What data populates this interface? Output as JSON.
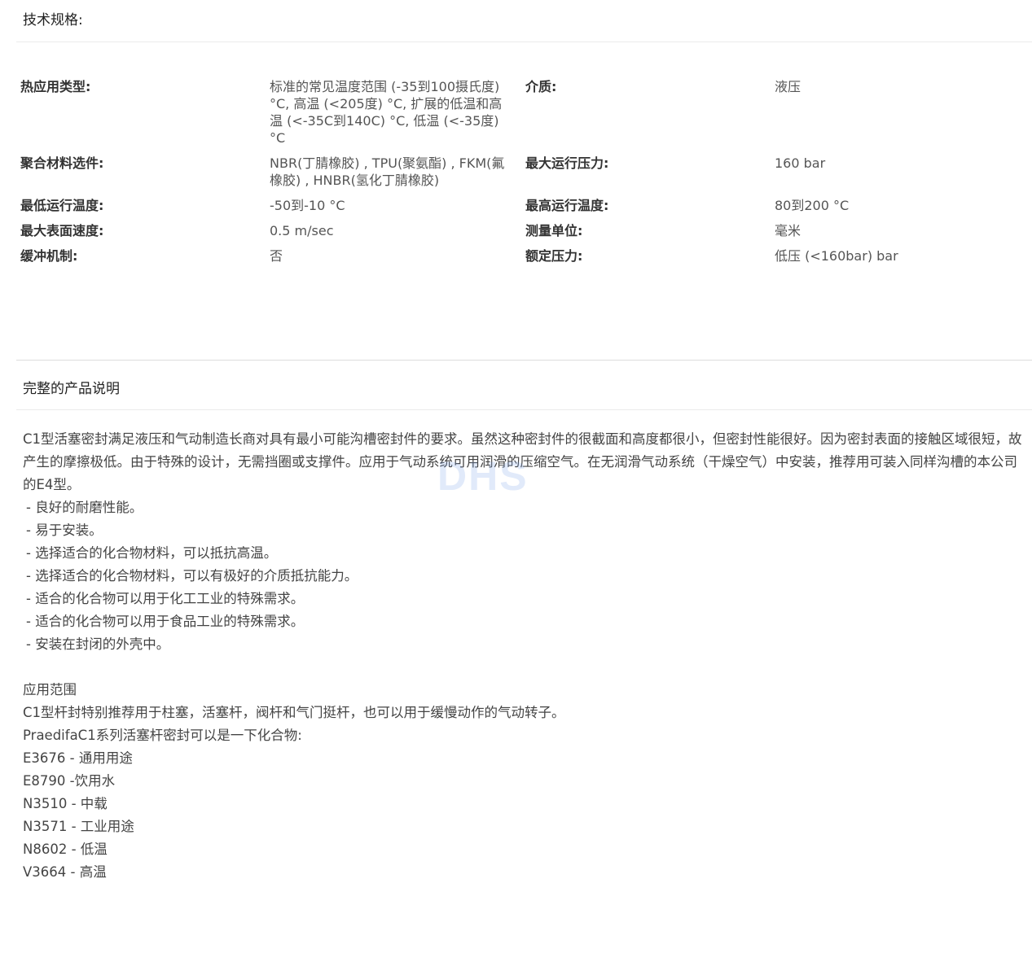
{
  "specs": {
    "header": "技术规格:",
    "rows": [
      [
        {
          "label": "热应用类型:",
          "value": "标准的常见温度范围 (-35到100摄氏度) °C, 高温 (<205度) °C, 扩展的低温和高温 (<-35C到140C) °C, 低温 (<-35度) °C"
        },
        {
          "label": "介质:",
          "value": "液压"
        }
      ],
      [
        {
          "label": "聚合材料选件:",
          "value": "NBR(丁腈橡胶) , TPU(聚氨酯) , FKM(氟橡胶) , HNBR(氢化丁腈橡胶)"
        },
        {
          "label": "最大运行压力:",
          "value": "160 bar"
        }
      ],
      [
        {
          "label": "最低运行温度:",
          "value": "-50到-10 °C"
        },
        {
          "label": "最高运行温度:",
          "value": "80到200 °C"
        }
      ],
      [
        {
          "label": "最大表面速度:",
          "value": "0.5 m/sec"
        },
        {
          "label": "测量单位:",
          "value": "毫米"
        }
      ],
      [
        {
          "label": "缓冲机制:",
          "value": "否"
        },
        {
          "label": "额定压力:",
          "value": "低压 (<160bar) bar"
        }
      ]
    ]
  },
  "description": {
    "header": "完整的产品说明",
    "intro": "C1型活塞密封满足液压和气动制造长商对具有最小可能沟槽密封件的要求。虽然这种密封件的很截面和高度都很小，但密封性能很好。因为密封表面的接触区域很短，故产生的摩擦极低。由于特殊的设计，无需挡圈或支撑件。应用于气动系统可用润滑的压缩空气。在无润滑气动系统（干燥空气）中安装，推荐用可装入同样沟槽的本公司的E4型。",
    "features": [
      "- 良好的耐磨性能。",
      "- 易于安装。",
      "- 选择适合的化合物材料，可以抵抗高温。",
      "- 选择适合的化合物材料，可以有极好的介质抵抗能力。",
      "- 适合的化合物可以用于化工工业的特殊需求。",
      "- 适合的化合物可以用于食品工业的特殊需求。",
      "- 安装在封闭的外壳中。"
    ],
    "application_title": "应用范围",
    "application_text": "C1型杆封特别推荐用于柱塞，活塞杆，阀杆和气门挺杆，也可以用于缓慢动作的气动转子。",
    "compounds_title": "PraedifaC1系列活塞杆密封可以是一下化合物:",
    "compounds": [
      "E3676 - 通用用途",
      "E8790 -饮用水",
      "N3510 - 中载",
      "N3571 - 工业用途",
      "N8602 - 低温",
      "V3664 - 高温"
    ]
  },
  "watermark": "DHS"
}
